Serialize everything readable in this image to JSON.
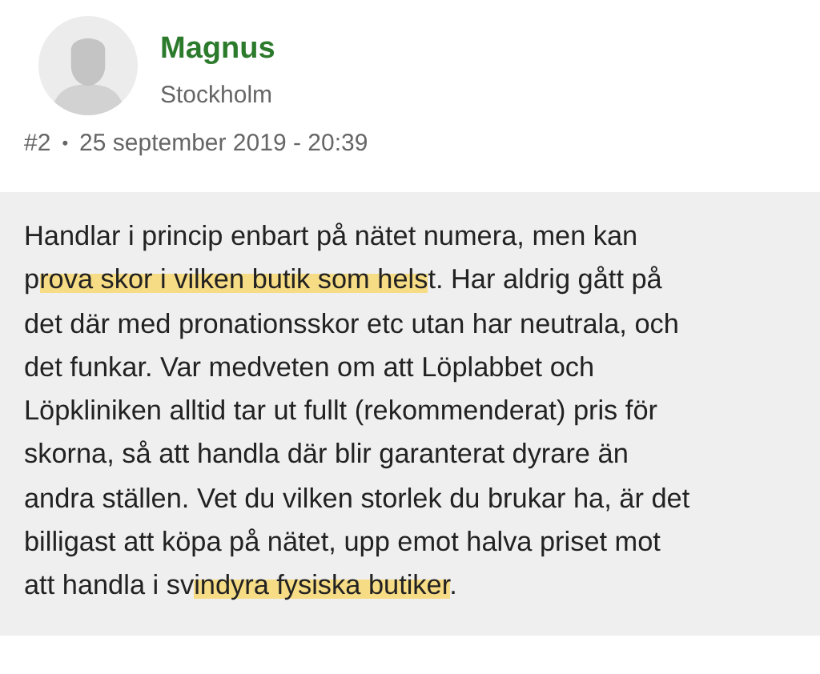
{
  "author": {
    "name": "Magnus",
    "location": "Stockholm"
  },
  "meta": {
    "post_number": "#2",
    "separator": "•",
    "timestamp": "25 september 2019 - 20:39"
  },
  "body": [
    {
      "text": "Handlar i princip enbart på nätet numera, men kan\np",
      "highlighted": false
    },
    {
      "text": "rova skor i vilken butik som hels",
      "highlighted": true
    },
    {
      "text": "t. Har aldrig gått på\ndet där med pronationsskor etc utan har neutrala, och\ndet funkar. Var medveten om att Löplabbet och\nLöpkliniken alltid tar ut fullt (rekommenderat) pris för\nskorna, så att handla där blir garanterat dyrare än\nandra ställen. Vet du vilken storlek du brukar ha, är det\nbilligast att köpa på nätet, upp emot halva priset mot\natt handla i sv",
      "highlighted": false
    },
    {
      "text": "indyra fysiska butiker",
      "highlighted": true
    },
    {
      "text": ".",
      "highlighted": false
    }
  ]
}
